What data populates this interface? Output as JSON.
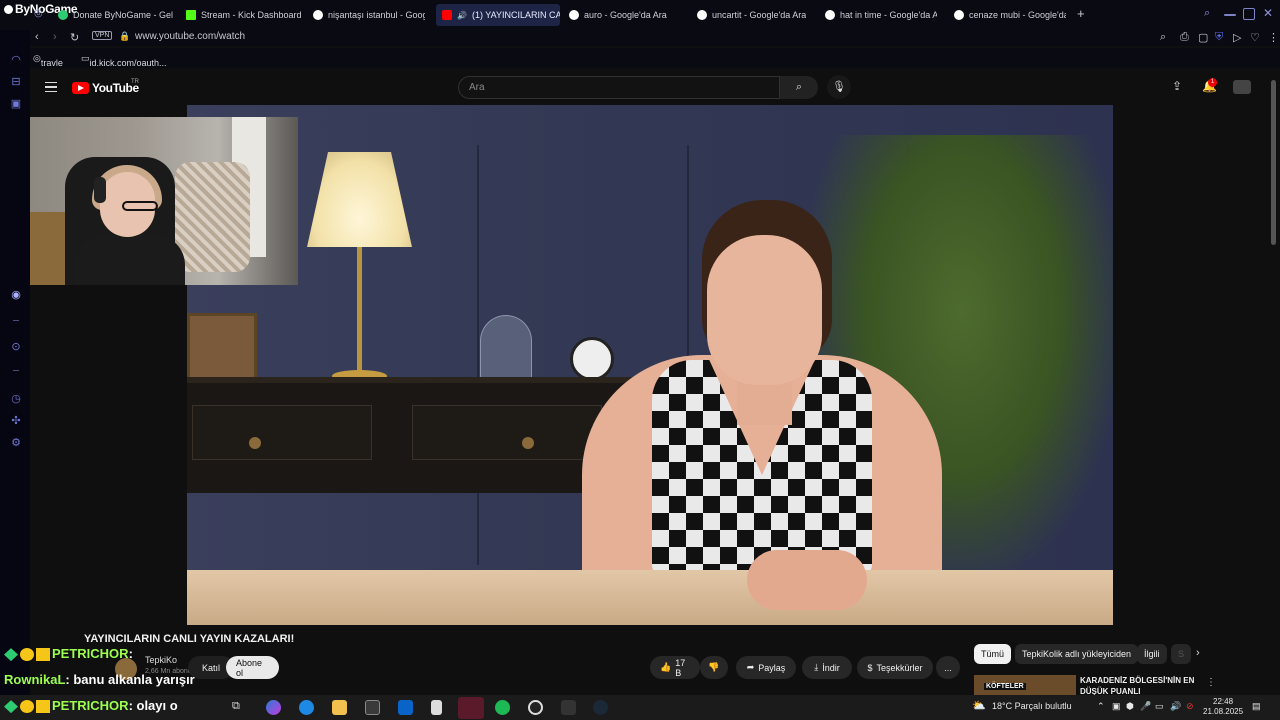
{
  "browser": {
    "brand": "ByNoGame",
    "tabs": [
      {
        "label": "Donate ByNoGame - Gel",
        "fav": "#2ecc71"
      },
      {
        "label": "Stream - Kick Dashboard",
        "fav": "#53fc18"
      },
      {
        "label": "nişantaşı istanbul - Googl",
        "fav": "#ffffff"
      },
      {
        "label": "(1) YAYINCILARIN CA",
        "fav": "#ff0000",
        "active": true
      },
      {
        "label": "auro - Google'da Ara",
        "fav": "#ffffff"
      },
      {
        "label": "uncartit - Google'da Ara",
        "fav": "#ffffff"
      },
      {
        "label": "hat in time - Google'da A",
        "fav": "#ffffff"
      },
      {
        "label": "cenaze mubi - Google'da",
        "fav": "#ffffff"
      }
    ],
    "new_tab": "+",
    "vpn": "VPN",
    "url": "www.youtube.com/watch",
    "bookmarks": [
      "travle",
      "id.kick.com/oauth..."
    ]
  },
  "youtube": {
    "logo": "YouTube",
    "region": "TR",
    "search_placeholder": "Ara",
    "notif_count": "1"
  },
  "video": {
    "title": "YAYINCILARIN CANLI YAYIN KAZALARI!",
    "channel": "TepkiKo",
    "subs": "2,66 Mn abone",
    "join": "Katıl",
    "subscribe": "Abone ol",
    "likes": "17 B",
    "share": "Paylaş",
    "download": "İndir",
    "thanks": "Teşekkürler",
    "more": "..."
  },
  "chips": [
    "Tümü",
    "TepkiKolik adlı yükleyiciden",
    "İlgili",
    "S"
  ],
  "recommended": {
    "thumb_text": "KÖFTELER",
    "title": "KARADENİZ BÖLGESİ'NİN EN DÜŞÜK PUANLI"
  },
  "chat": [
    {
      "user": "PETRICHOR",
      "msg": ":"
    },
    {
      "user": "RownikaL",
      "msg": ": banu alkanla yarışır"
    },
    {
      "user": "PETRICHOR",
      "msg": ": olayı o"
    }
  ],
  "taskbar": {
    "weather": "18°C  Parçalı bulutlu",
    "time": "22:48",
    "date": "21.08.2025"
  }
}
